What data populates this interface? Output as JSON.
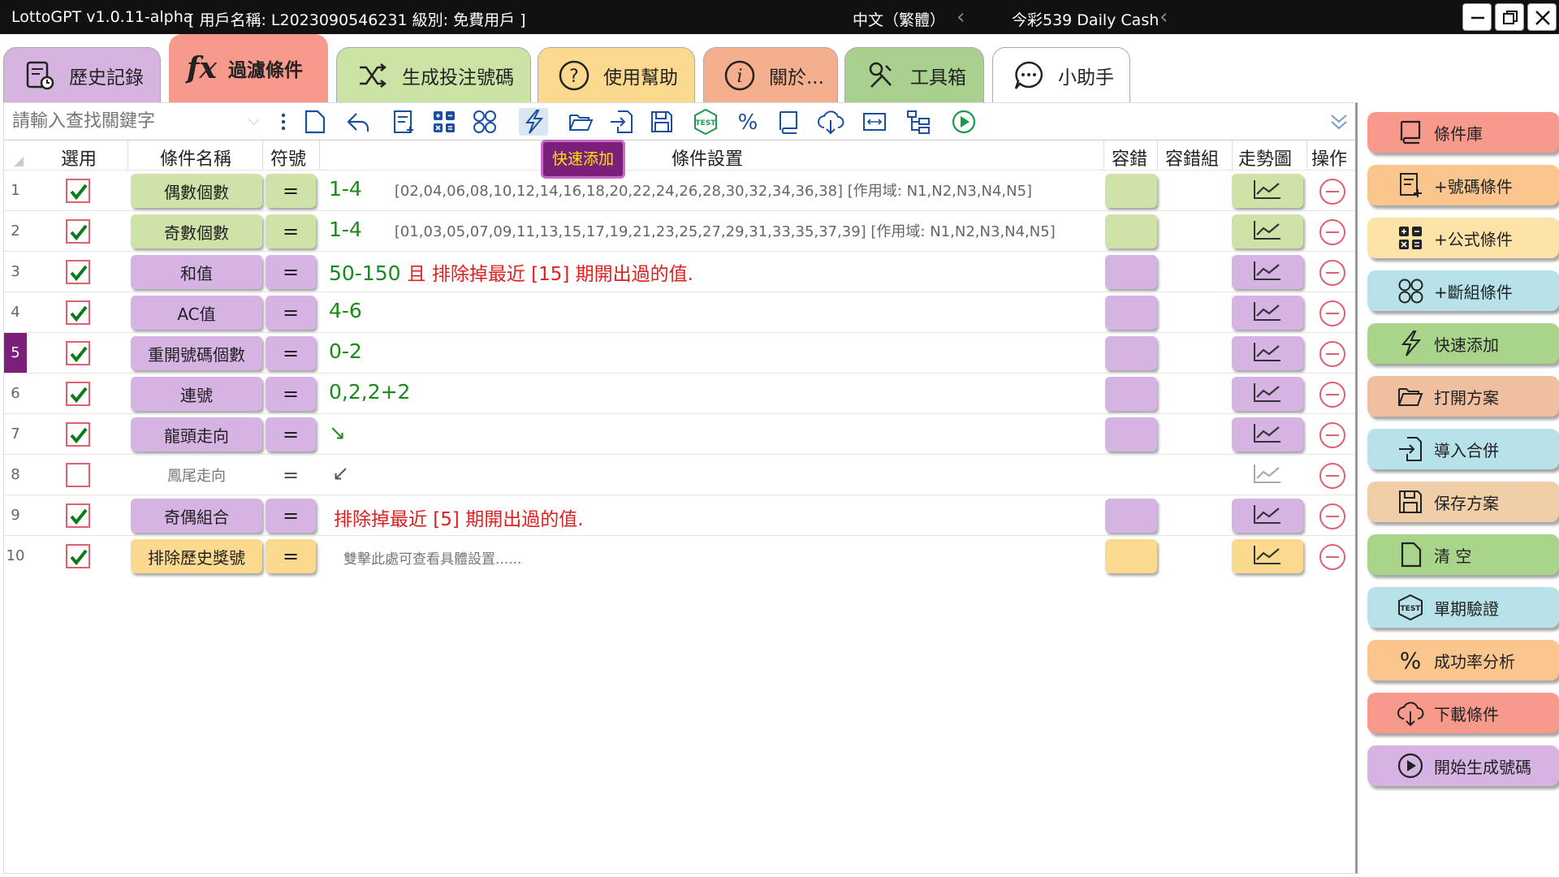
{
  "titlebar": {
    "app": "LottoGPT v1.0.11-alpha",
    "user": "[ 用戶名稱: L2023090546231  級別: 免費用戶 ]",
    "language": "中文（繁體）",
    "game": "今彩539 Daily Cash"
  },
  "tabs": [
    {
      "label": "歷史記錄",
      "icon": "history-icon",
      "color": "#d6b4e0"
    },
    {
      "label": "過濾條件",
      "icon": "fx-icon",
      "color": "#f79a8c"
    },
    {
      "label": "生成投注號碼",
      "icon": "shuffle-icon",
      "color": "#cbe3a4"
    },
    {
      "label": "使用幫助",
      "icon": "help-icon",
      "color": "#fbd98e"
    },
    {
      "label": "關於...",
      "icon": "info-icon",
      "color": "#f4b08e"
    },
    {
      "label": "工具箱",
      "icon": "tools-icon",
      "color": "#a9d08e"
    },
    {
      "label": "小助手",
      "icon": "chat-icon",
      "color": "#ffffff"
    }
  ],
  "search": {
    "placeholder": "請輸入查找關鍵字"
  },
  "tooltip": "快速添加",
  "table": {
    "headers": {
      "use": "選用",
      "name": "條件名稱",
      "op": "符號",
      "setting": "條件設置",
      "tol": "容錯",
      "tolgroup": "容錯組",
      "trend": "走勢圖",
      "action": "操作"
    },
    "rows": [
      {
        "num": "1",
        "checked": true,
        "name": "偶數個數",
        "op": "=",
        "cond": "1-4",
        "detail": "[02,04,06,08,10,12,14,16,18,20,22,24,26,28,30,32,34,36,38] [作用域:   N1,N2,N3,N4,N5]",
        "style": "green",
        "color": "#cfe2a8"
      },
      {
        "num": "2",
        "checked": true,
        "name": "奇數個數",
        "op": "=",
        "cond": "1-4",
        "detail": "[01,03,05,07,09,11,13,15,17,19,21,23,25,27,29,31,33,35,37,39] [作用域:   N1,N2,N3,N4,N5]",
        "style": "green",
        "color": "#cfe2a8"
      },
      {
        "num": "3",
        "checked": true,
        "name": "和值",
        "op": "=",
        "cond": "50-150",
        "detail": "且 排除掉最近 [15] 期開出過的值.",
        "style": "mix",
        "color": "#d5b3e2"
      },
      {
        "num": "4",
        "checked": true,
        "name": "AC值",
        "op": "=",
        "cond": "4-6",
        "detail": "",
        "style": "green",
        "color": "#d5b3e2"
      },
      {
        "num": "5",
        "checked": true,
        "name": "重開號碼個數",
        "op": "=",
        "cond": "0-2",
        "detail": "",
        "style": "green",
        "color": "#d5b3e2"
      },
      {
        "num": "6",
        "checked": true,
        "name": "連號",
        "op": "=",
        "cond": "0,2,2+2",
        "detail": "",
        "style": "green",
        "color": "#d5b3e2"
      },
      {
        "num": "7",
        "checked": true,
        "name": "龍頭走向",
        "op": "=",
        "cond": "↘",
        "detail": "",
        "style": "green",
        "color": "#d5b3e2"
      },
      {
        "num": "8",
        "checked": false,
        "name": "鳳尾走向",
        "op": "=",
        "cond": "↙",
        "detail": "",
        "style": "plain",
        "color": "#ffffff"
      },
      {
        "num": "9",
        "checked": true,
        "name": "奇偶組合",
        "op": "=",
        "cond": "排除掉最近 [5] 期開出過的值.",
        "detail": "",
        "style": "red",
        "color": "#d5b3e2"
      },
      {
        "num": "10",
        "checked": true,
        "name": "排除歷史獎號",
        "op": "=",
        "cond": "雙擊此處可查看具體設置......",
        "detail": "",
        "style": "gray",
        "color": "#fbd98e"
      }
    ]
  },
  "sidebar": [
    {
      "label": "條件庫",
      "icon": "library-icon",
      "color": "#f79a8c"
    },
    {
      "label": "+號碼條件",
      "icon": "number-condition-icon",
      "color": "#fbc58e"
    },
    {
      "label": "+公式條件",
      "icon": "formula-icon",
      "color": "#fde3a8"
    },
    {
      "label": "+斷組條件",
      "icon": "group-icon",
      "color": "#b7e2ea"
    },
    {
      "label": "快速添加",
      "icon": "lightning-icon",
      "color": "#a9d58a"
    },
    {
      "label": "打開方案",
      "icon": "folder-open-icon",
      "color": "#f0bfa0"
    },
    {
      "label": "導入合併",
      "icon": "import-icon",
      "color": "#b7e2ea"
    },
    {
      "label": "保存方案",
      "icon": "save-icon",
      "color": "#f0cfa8"
    },
    {
      "label": "清 空",
      "icon": "new-page-icon",
      "color": "#a9d58a"
    },
    {
      "label": "單期驗證",
      "icon": "test-icon",
      "color": "#b7e2ea"
    },
    {
      "label": "成功率分析",
      "icon": "percent-icon",
      "color": "#fbc58e"
    },
    {
      "label": "下載條件",
      "icon": "cloud-download-icon",
      "color": "#f79a8c"
    },
    {
      "label": "開始生成號碼",
      "icon": "play-icon",
      "color": "#d5b3e2"
    }
  ]
}
